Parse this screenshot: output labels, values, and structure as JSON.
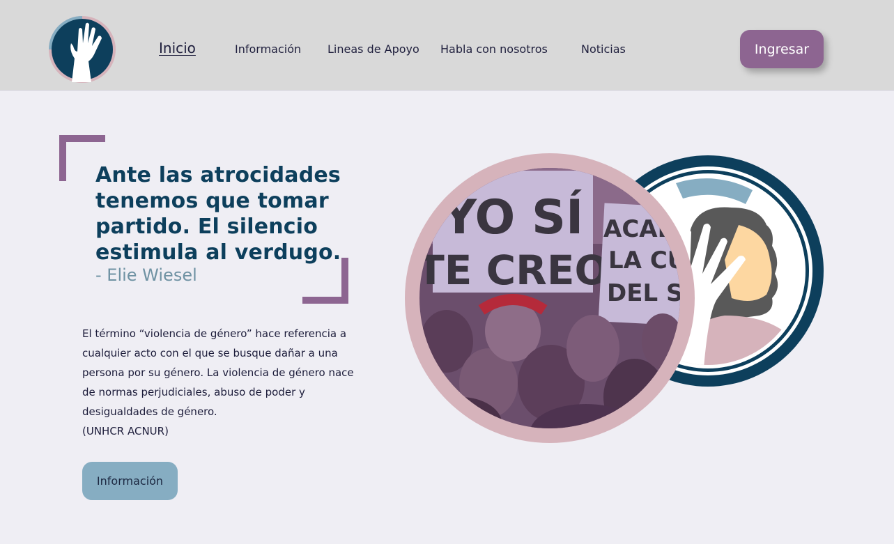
{
  "header": {
    "logo": {
      "icon": "raised-hand-icon"
    },
    "nav": [
      {
        "label": "Inicio",
        "active": true
      },
      {
        "label": "Información",
        "active": false
      },
      {
        "label": "Lineas de Apoyo",
        "active": false
      },
      {
        "label": "Habla con nosotros",
        "active": false
      },
      {
        "label": "Noticias",
        "active": false
      }
    ],
    "login_label": "Ingresar"
  },
  "hero": {
    "quote": "Ante las atrocidades tenemos que tomar partido. El silencio estimula al verdugo.",
    "author": "- Elie Wiesel",
    "description": "El término “violencia de género” hace referencia a cualquier acto con el que se busque dañar a una persona por su género. La violencia de género nace de normas perjudiciales, abuso de poder y desigualdades de género.",
    "source": "(UNHCR ACNUR)",
    "info_button": "Información"
  },
  "illustration": {
    "photo_signs": [
      "YO SÍ",
      "TE CREO",
      "ACABE",
      "LA CU",
      "DEL SI"
    ]
  },
  "colors": {
    "header_bg": "#d9d9d9",
    "page_bg": "#efeef4",
    "purple_accent": "#8d6591",
    "navy": "#0d3f5c",
    "light_blue": "#86adc2",
    "pink": "#d6b3bb"
  }
}
